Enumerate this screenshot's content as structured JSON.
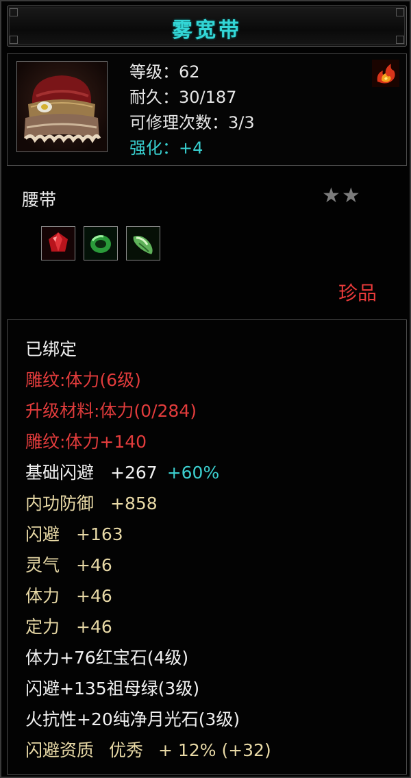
{
  "item": {
    "name": "雾宽带",
    "stats": {
      "level": "等级：62",
      "durability": "耐久：30/187",
      "repairs": "可修理次数：3/3",
      "enhance_label": "强化：",
      "enhance_value": "+4"
    },
    "type": "腰带",
    "stars": "★★",
    "rarity": "珍品"
  },
  "attributes": {
    "bound": "已绑定",
    "engraving": "雕纹:体力(6级)",
    "upgrade_material": "升级材料:体力(0/284)",
    "engraving_bonus": "雕纹:体力+140",
    "base_dodge_label": "基础闪避",
    "base_dodge_value": "+267",
    "base_dodge_pct": "+60%",
    "inner_def_label": "内功防御",
    "inner_def_value": "+858",
    "dodge_label": "闪避",
    "dodge_value": "+163",
    "spirit_label": "灵气",
    "spirit_value": "+46",
    "stamina_label": "体力",
    "stamina_value": "+46",
    "focus_label": "定力",
    "focus_value": "+46",
    "gem1": "体力+76红宝石(4级)",
    "gem2": "闪避+135祖母绿(3级)",
    "gem3": "火抗性+20纯净月光石(3级)",
    "quality_label": "闪避资质",
    "quality_grade": "优秀",
    "quality_value": "+ 12% (+32)"
  },
  "icons": {
    "item": "belt-icon",
    "fire": "fire-emblem-icon",
    "gems": [
      "ruby-gem-icon",
      "emerald-gem-icon",
      "moonstone-gem-icon"
    ]
  },
  "colors": {
    "title": "#33d6d6",
    "red_text": "#e23c3c",
    "gold_text": "#e8d9a6",
    "cyan_text": "#3ccfcf"
  }
}
